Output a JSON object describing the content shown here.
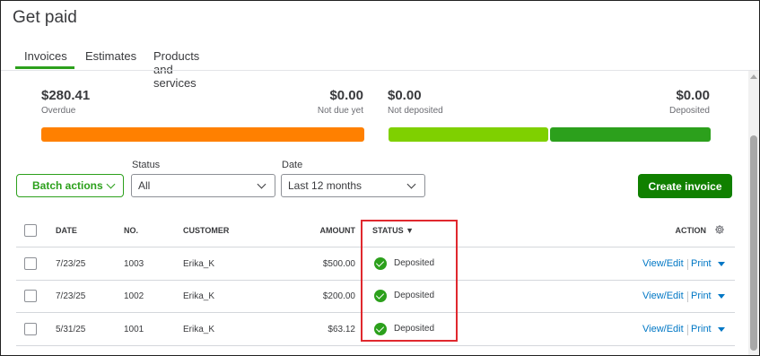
{
  "page_title": "Get paid",
  "tabs": [
    {
      "label": "Invoices",
      "active": true
    },
    {
      "label": "Estimates",
      "active": false
    },
    {
      "label": "Products and services",
      "active": false
    }
  ],
  "summary": {
    "overdue": {
      "amount": "$280.41",
      "label": "Overdue"
    },
    "not_due": {
      "amount": "$0.00",
      "label": "Not due yet"
    },
    "not_deposited": {
      "amount": "$0.00",
      "label": "Not deposited"
    },
    "deposited": {
      "amount": "$0.00",
      "label": "Deposited"
    }
  },
  "colors": {
    "overdue_bar": "#ff8000",
    "not_deposited_bar": "#7fd000",
    "deposited_bar": "#2ca01c",
    "accent": "#2ca01c",
    "link": "#0077c5",
    "highlight": "#e0282e"
  },
  "filters": {
    "batch_actions_label": "Batch actions",
    "status_label": "Status",
    "status_value": "All",
    "date_label": "Date",
    "date_value": "Last 12 months",
    "create_invoice_label": "Create invoice"
  },
  "table": {
    "headers": {
      "date": "DATE",
      "no": "NO.",
      "customer": "CUSTOMER",
      "amount": "AMOUNT",
      "status": "STATUS ▼",
      "action": "ACTION"
    },
    "rows": [
      {
        "date": "7/23/25",
        "no": "1003",
        "customer": "Erika_K",
        "amount": "$500.00",
        "status": "Deposited",
        "view_edit": "View/Edit",
        "print": "Print"
      },
      {
        "date": "7/23/25",
        "no": "1002",
        "customer": "Erika_K",
        "amount": "$200.00",
        "status": "Deposited",
        "view_edit": "View/Edit",
        "print": "Print"
      },
      {
        "date": "5/31/25",
        "no": "1001",
        "customer": "Erika_K",
        "amount": "$63.12",
        "status": "Deposited",
        "view_edit": "View/Edit",
        "print": "Print"
      }
    ]
  }
}
